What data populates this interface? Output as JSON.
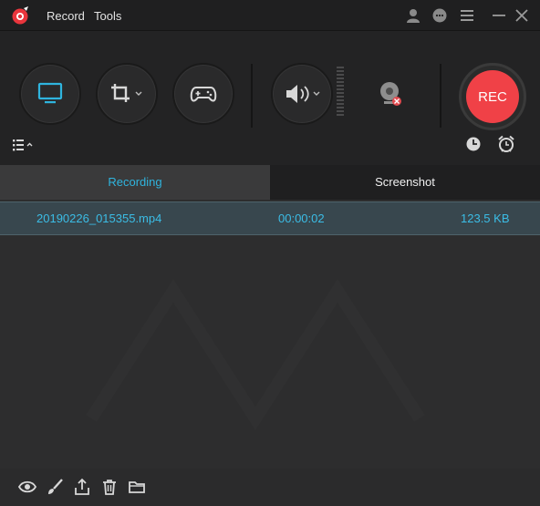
{
  "menu": {
    "record": "Record",
    "tools": "Tools"
  },
  "toolbar": {
    "rec_label": "REC",
    "icons": [
      "monitor-icon",
      "crop-region-icon",
      "gamepad-icon",
      "speaker-icon",
      "webcam-icon",
      "list-icon",
      "clock-icon",
      "alarm-icon"
    ]
  },
  "tabs": {
    "recording": "Recording",
    "screenshot": "Screenshot"
  },
  "files": [
    {
      "name": "20190226_015355.mp4",
      "duration": "00:00:02",
      "size": "123.5 KB"
    }
  ],
  "colors": {
    "accent": "#2fb4de",
    "rec": "#f04147",
    "background": "#2b2b2c"
  }
}
